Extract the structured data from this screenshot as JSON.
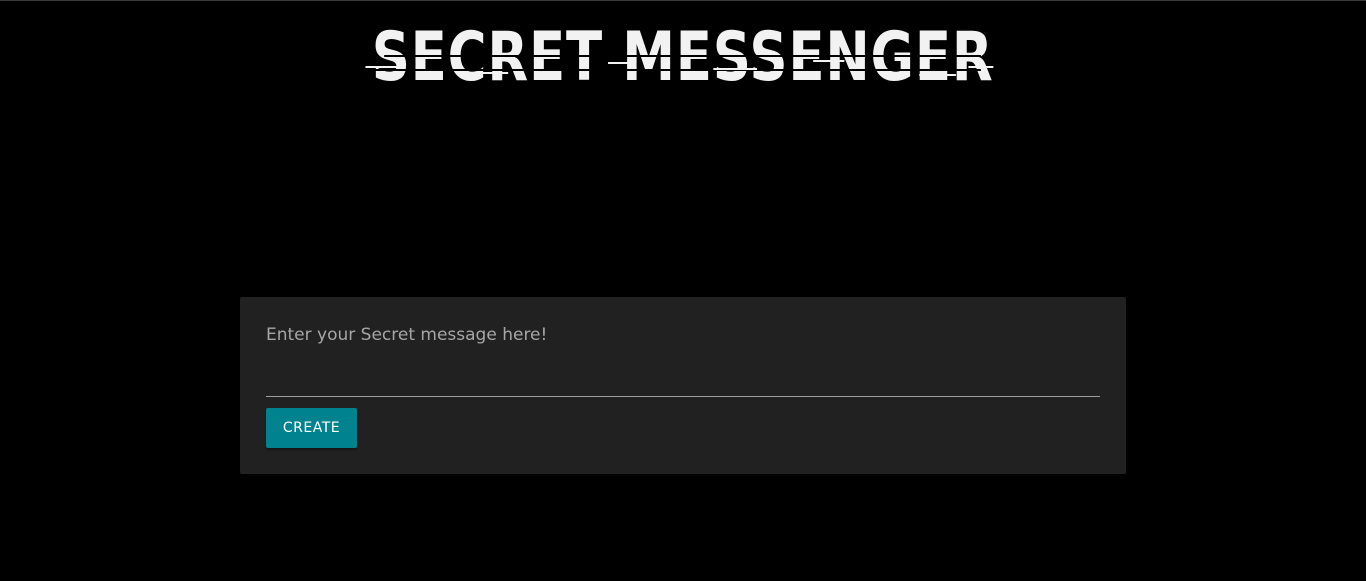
{
  "header": {
    "logo_text": "SECRET MESSENGER"
  },
  "form": {
    "message_placeholder": "Enter your Secret message here!",
    "message_value": "",
    "create_label": "CREATE"
  },
  "colors": {
    "background": "#000000",
    "card": "#212121",
    "accent": "#00838f",
    "logo": "#f2f2f2"
  }
}
